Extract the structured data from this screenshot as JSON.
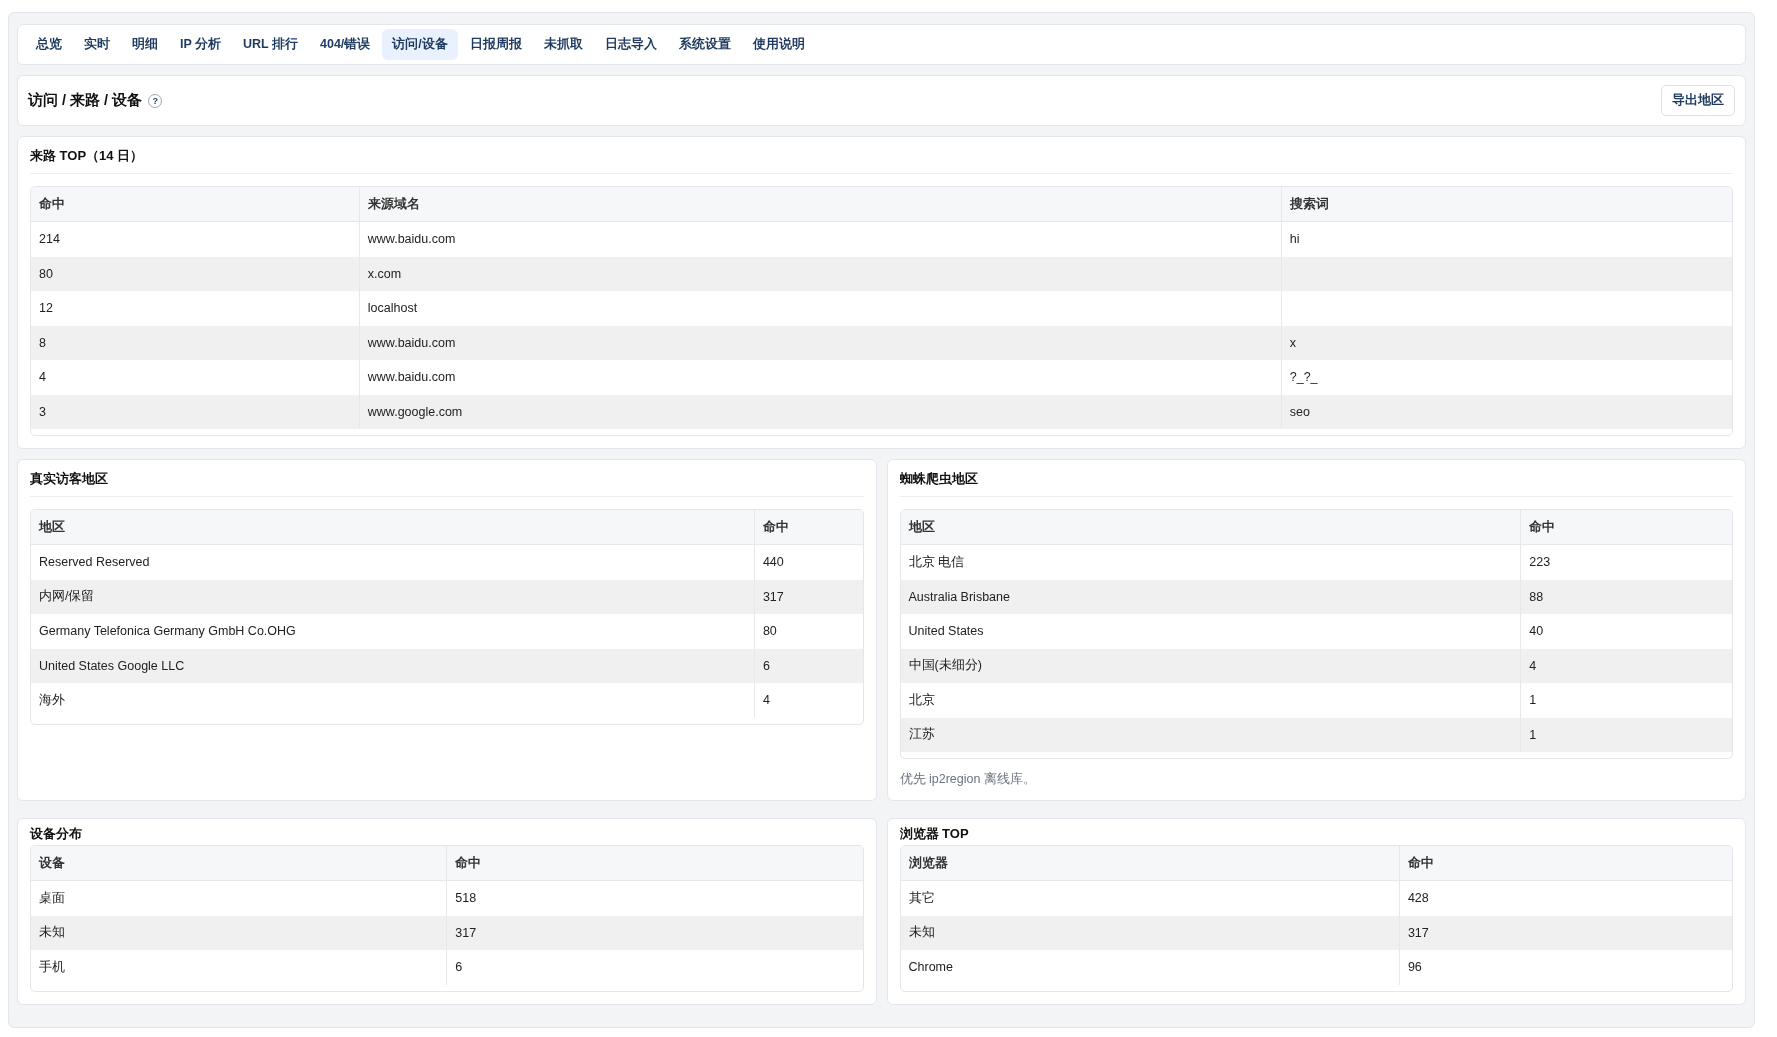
{
  "tabs": [
    {
      "label": "总览",
      "selected": false
    },
    {
      "label": "实时",
      "selected": false
    },
    {
      "label": "明细",
      "selected": false
    },
    {
      "label": "IP 分析",
      "selected": false
    },
    {
      "label": "URL 排行",
      "selected": false
    },
    {
      "label": "404/错误",
      "selected": false
    },
    {
      "label": "访问/设备",
      "selected": true
    },
    {
      "label": "日报周报",
      "selected": false
    },
    {
      "label": "未抓取",
      "selected": false
    },
    {
      "label": "日志导入",
      "selected": false
    },
    {
      "label": "系统设置",
      "selected": false
    },
    {
      "label": "使用说明",
      "selected": false
    }
  ],
  "header": {
    "title": "访问 / 来路 / 设备",
    "help": "?",
    "export_button": "导出地区"
  },
  "referers": {
    "title": "来路 TOP（14 日）",
    "columns": [
      "命中",
      "来源域名",
      "搜索词"
    ],
    "rows": [
      [
        "214",
        "www.baidu.com",
        "hi"
      ],
      [
        "80",
        "x.com"
      ],
      [
        "12",
        "localhost"
      ],
      [
        "8",
        "www.baidu.com",
        "x"
      ],
      [
        "4",
        "www.baidu.com",
        "?_?_"
      ],
      [
        "3",
        "www.google.com",
        "seo"
      ]
    ]
  },
  "panels": [
    {
      "title": "真实访客地区",
      "columns": [
        "地区",
        "命中"
      ],
      "rows": [
        [
          "Reserved Reserved",
          "440"
        ],
        [
          "内网/保留",
          "317"
        ],
        [
          "Germany Telefonica Germany GmbH Co.OHG",
          "80"
        ],
        [
          "United States Google LLC",
          "6"
        ],
        [
          "海外",
          "4"
        ]
      ]
    },
    {
      "title": "蜘蛛爬虫地区",
      "columns": [
        "地区",
        "命中"
      ],
      "rows": [
        [
          "北京 电信",
          "223"
        ],
        [
          "Australia Brisbane",
          "88"
        ],
        [
          "United States",
          "40"
        ],
        [
          "中国(未细分)",
          "4"
        ],
        [
          "北京",
          "1"
        ],
        [
          "江苏",
          "1"
        ]
      ],
      "note": "优先 ip2region 离线库。"
    },
    {
      "title": "设备分布",
      "columns": [
        "设备",
        "命中"
      ],
      "rows": [
        [
          "桌面",
          "518"
        ],
        [
          "未知",
          "317"
        ],
        [
          "手机",
          "6"
        ]
      ]
    },
    {
      "title": "浏览器 TOP",
      "columns": [
        "浏览器",
        "命中"
      ],
      "rows": [
        [
          "其它",
          "428"
        ],
        [
          "未知",
          "317"
        ],
        [
          "Chrome",
          "96"
        ]
      ]
    }
  ]
}
